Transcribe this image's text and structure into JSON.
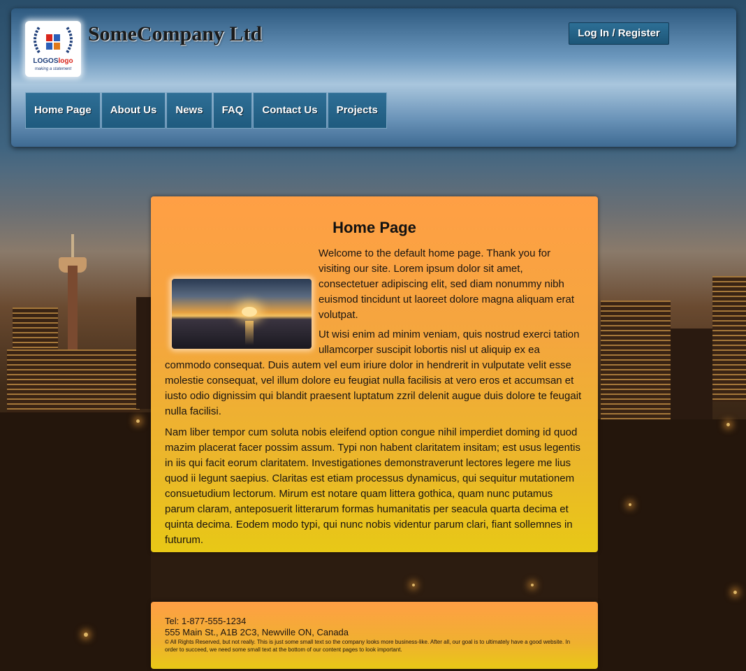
{
  "header": {
    "company_name": "SomeCompany Ltd",
    "login_label": "Log In / Register",
    "logo": {
      "text_main": "LOGOS",
      "text_accent": "logo",
      "tagline": "making a statement"
    }
  },
  "nav": {
    "items": [
      {
        "label": "Home Page"
      },
      {
        "label": "About Us"
      },
      {
        "label": "News"
      },
      {
        "label": "FAQ"
      },
      {
        "label": "Contact Us"
      },
      {
        "label": "Projects"
      }
    ]
  },
  "main": {
    "title": "Home Page",
    "paragraph1_start": "Welcome to the default home page. Thank you for visiting our site. Lorem ipsum dolor sit amet, consectetuer adipiscing elit, sed diam nonummy nibh euismod tincidunt ut laoreet dolore magna aliquam erat volutpat.",
    "paragraph2": "Ut wisi enim ad minim veniam, quis nostrud exerci tation ullamcorper suscipit lobortis nisl ut aliquip ex ea commodo consequat. Duis autem vel eum iriure dolor in hendrerit in vulputate velit esse molestie consequat, vel illum dolore eu feugiat nulla facilisis at vero eros et accumsan et iusto odio dignissim qui blandit praesent luptatum zzril delenit augue duis dolore te feugait nulla facilisi.",
    "paragraph3": "Nam liber tempor cum soluta nobis eleifend option congue nihil imperdiet doming id quod mazim placerat facer possim assum. Typi non habent claritatem insitam; est usus legentis in iis qui facit eorum claritatem. Investigationes demonstraverunt lectores legere me lius quod ii legunt saepius. Claritas est etiam processus dynamicus, qui sequitur mutationem consuetudium lectorum. Mirum est notare quam littera gothica, quam nunc putamus parum claram, anteposuerit litterarum formas humanitatis per seacula quarta decima et quinta decima. Eodem modo typi, qui nunc nobis videntur parum clari, fiant sollemnes in futurum."
  },
  "footer": {
    "tel": "Tel: 1-877-555-1234",
    "address": "555 Main St., A1B 2C3, Newville ON, Canada",
    "copyright": "© All Rights Reserved, but not really. This is just some small text so the company looks more business-like. After all, our goal is to ultimately have a good website. In order to succeed, we need some small text at the bottom of our content pages to look important."
  },
  "colors": {
    "header_blue": "#1e5a7e",
    "panel_orange": "#ff9f45",
    "panel_yellow": "#e8c816"
  }
}
